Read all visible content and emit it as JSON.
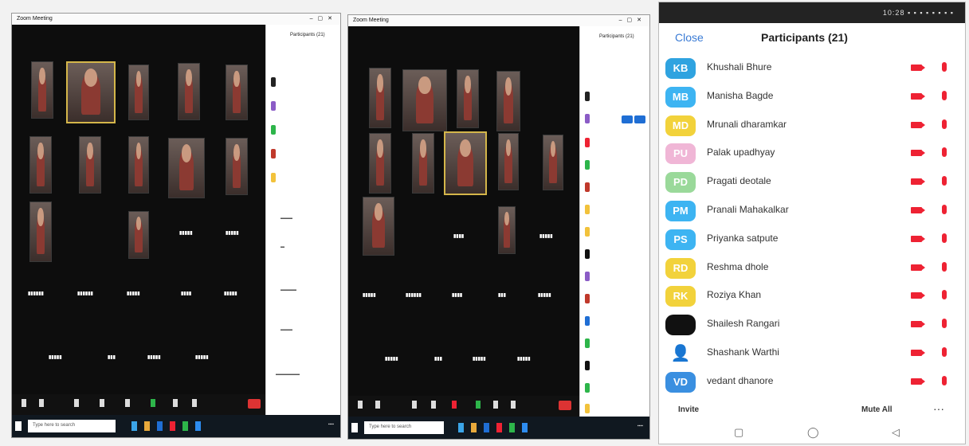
{
  "desktop1": {
    "window_title": "Zoom Meeting",
    "panel_title": "Participants (21)",
    "search_placeholder": "Type here to search"
  },
  "desktop2": {
    "window_title": "Zoom Meeting",
    "panel_title": "Participants (21)",
    "search_placeholder": "Type here to search"
  },
  "phone": {
    "status_time": "10:28",
    "header": {
      "close_label": "Close",
      "title": "Participants (21)"
    },
    "participants": [
      {
        "initials": "KB",
        "name": "Khushali Bhure",
        "color": "#2fa3e0"
      },
      {
        "initials": "MB",
        "name": "Manisha Bagde",
        "color": "#3db4f2"
      },
      {
        "initials": "MD",
        "name": "Mrunali dharamkar",
        "color": "#f2d23b"
      },
      {
        "initials": "PU",
        "name": "Palak upadhyay",
        "color": "#f0b6d6"
      },
      {
        "initials": "PD",
        "name": "Pragati deotale",
        "color": "#9ad99a"
      },
      {
        "initials": "PM",
        "name": "Pranali Mahakalkar",
        "color": "#3db4f2"
      },
      {
        "initials": "PS",
        "name": "Priyanka satpute",
        "color": "#3db4f2"
      },
      {
        "initials": "RD",
        "name": "Reshma dhole",
        "color": "#f2d23b"
      },
      {
        "initials": "RK",
        "name": "Roziya Khan",
        "color": "#f2d23b"
      },
      {
        "initials": "",
        "name": "Shailesh Rangari",
        "color": "#111111"
      },
      {
        "initials": "",
        "name": "Shashank Warthi",
        "color": "#ffffff"
      },
      {
        "initials": "VD",
        "name": "vedant dhanore",
        "color": "#3a8fe0"
      }
    ],
    "footer": {
      "invite_label": "Invite",
      "mute_all_label": "Mute All",
      "more_label": "···"
    },
    "nav": {
      "recent": "▢",
      "home": "◯",
      "back": "◁"
    }
  }
}
